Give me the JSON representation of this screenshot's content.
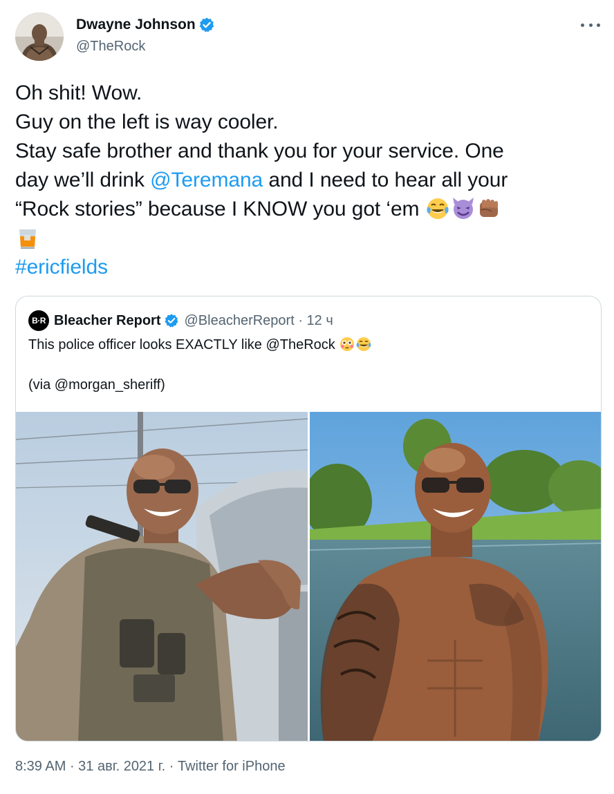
{
  "author": {
    "name": "Dwayne Johnson",
    "handle": "@TheRock",
    "avatar_icon": "avatar-photo",
    "verified_icon": "verified-badge-icon"
  },
  "tweet": {
    "line1": "Oh shit! Wow.",
    "line2": "Guy on the left is way cooler.",
    "line3": "Stay safe brother and thank you for your service. One",
    "line4_a": "day we’ll drink ",
    "line4_mention": "@Teremana",
    "line4_b": " and I need to hear all your",
    "line5": "“Rock stories” because I KNOW you got ‘em ",
    "emojis_line5": [
      "tears-of-joy-emoji",
      "smiling-devil-emoji",
      "fist-bump-emoji"
    ],
    "emoji_line6": "whiskey-glass-emoji",
    "hashtag": "#ericfields"
  },
  "quote": {
    "logo_text": "B·R",
    "name": "Bleacher Report",
    "handle": "@BleacherReport · 12 ч",
    "text": "This police officer looks EXACTLY like @TheRock ",
    "text_emojis": [
      "flushed-face-emoji",
      "tears-of-joy-emoji"
    ],
    "via": "(via @morgan_sheriff)",
    "photos": [
      "police-officer-photo",
      "the-rock-lake-photo"
    ]
  },
  "footer": {
    "time": "8:39 AM",
    "sep1": " · ",
    "date": "31 авг. 2021 г.",
    "sep2": " · ",
    "source": "Twitter for iPhone"
  },
  "colors": {
    "link": "#1d9bf0",
    "secondary_text": "#536471",
    "border": "#cfd9de"
  }
}
